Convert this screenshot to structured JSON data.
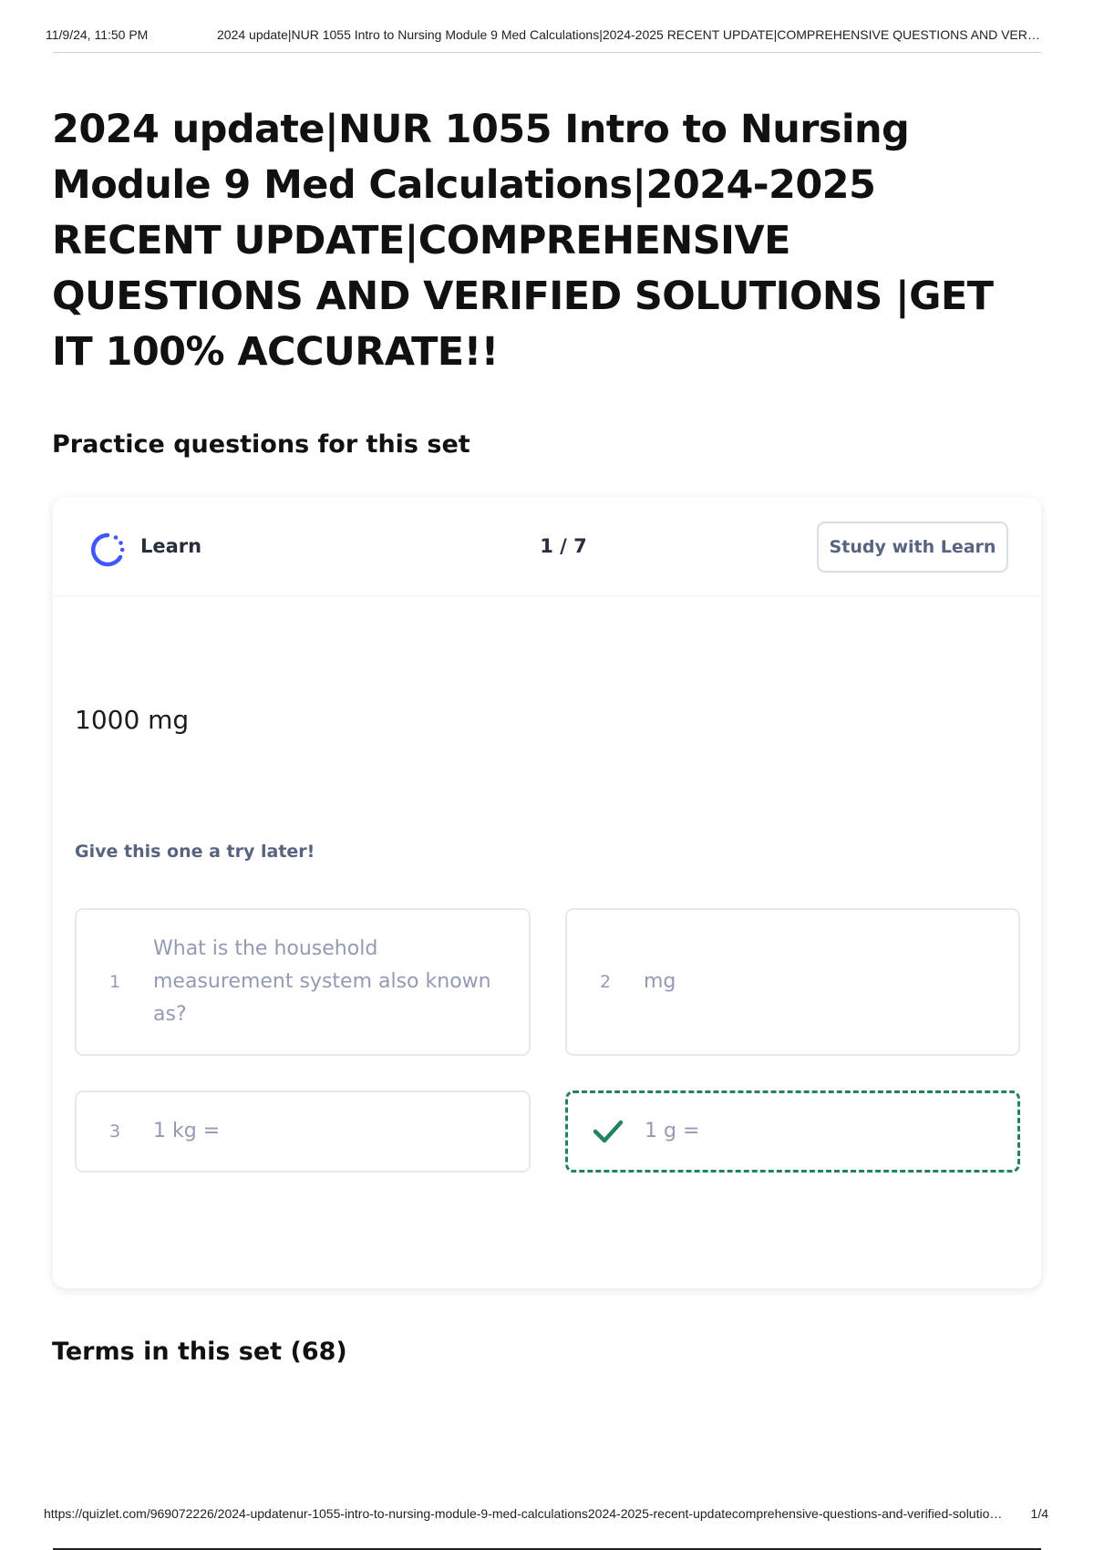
{
  "print_header": {
    "date": "11/9/24, 11:50 PM",
    "title": "2024 update|NUR 1055 Intro to Nursing Module 9 Med Calculations|2024-2025 RECENT UPDATE|COMPREHENSIVE QUESTIONS AND VERIFIED SOLUTIONS |GET IT 100% ACCURATE!!"
  },
  "page_title": "2024 update|NUR 1055 Intro to Nursing Module 9 Med Calculations|2024-2025 RECENT UPDATE|COMPREHENSIVE QUESTIONS AND VERIFIED SOLUTIONS |GET IT 100% ACCURATE!!",
  "practice": {
    "heading": "Practice questions for this set",
    "mode_label": "Learn",
    "mode_icon": "learn-progress-icon",
    "progress": "1 / 7",
    "study_button": "Study with Learn",
    "term": "1000 mg",
    "hint": "Give this one a try later!",
    "options": [
      {
        "number": "1",
        "text": "What is the household measurement system also known as?"
      },
      {
        "number": "2",
        "text": "mg"
      },
      {
        "number": "3",
        "text": "1 kg ="
      },
      {
        "text": "1 g =",
        "icon": "check-icon",
        "state": "correct"
      }
    ],
    "accent_color": "#4255ff",
    "correct_color": "#23825f"
  },
  "terms": {
    "heading": "Terms in this set (68)"
  },
  "print_footer": {
    "url": "https://quizlet.com/969072226/2024-updatenur-1055-intro-to-nursing-module-9-med-calculations2024-2025-recent-updatecomprehensive-questions-and-verified-solutions-get-it-100-accurate-flash-cards/",
    "page": "1/4"
  }
}
